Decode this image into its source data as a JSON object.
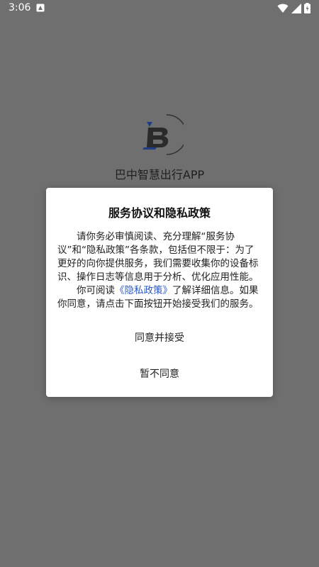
{
  "status_bar": {
    "time": "3:06"
  },
  "app": {
    "name": "巴中智慧出行APP"
  },
  "dialog": {
    "title": "服务协议和隐私政策",
    "para1": "请你务必审慎阅读、充分理解“服务协议”和“隐私政策”各条款，包括但不限于：为了更好的向你提供服务，我们需要收集你的设备标识、操作日志等信息用于分析、优化应用性能。",
    "para2_before": "你可阅读",
    "para2_link": "《隐私政策》",
    "para2_after": "了解详细信息。如果你同意，请点击下面按钮开始接受我们的服务。",
    "agree_label": "同意并接受",
    "disagree_label": "暂不同意"
  },
  "colors": {
    "overlay_background": "#6f6f6f",
    "link": "#2b59c3",
    "dialog_background": "#ffffff"
  },
  "icons": [
    "notification-icon",
    "wifi-icon",
    "signal-icon",
    "battery-icon",
    "app-logo-icon"
  ]
}
